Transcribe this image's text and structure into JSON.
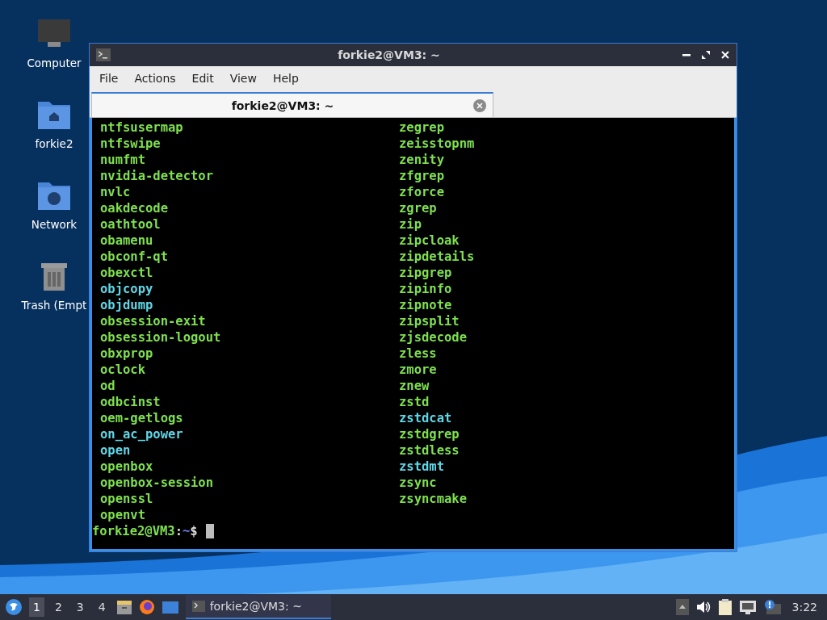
{
  "desktop_icons": [
    {
      "label": "Computer",
      "kind": "computer"
    },
    {
      "label": "forkie2",
      "kind": "home"
    },
    {
      "label": "Network",
      "kind": "network"
    },
    {
      "label": "Trash (Empt",
      "kind": "trash"
    }
  ],
  "window": {
    "title": "forkie2@VM3: ~",
    "menu": [
      "File",
      "Actions",
      "Edit",
      "View",
      "Help"
    ],
    "tabs": [
      {
        "label": "forkie2@VM3: ~",
        "selected": true
      }
    ]
  },
  "terminal": {
    "columns": [
      [
        {
          "text": "ntfsusermap",
          "kind": "executable"
        },
        {
          "text": "ntfswipe",
          "kind": "executable"
        },
        {
          "text": "numfmt",
          "kind": "executable"
        },
        {
          "text": "nvidia-detector",
          "kind": "executable"
        },
        {
          "text": "nvlc",
          "kind": "executable"
        },
        {
          "text": "oakdecode",
          "kind": "executable"
        },
        {
          "text": "oathtool",
          "kind": "executable"
        },
        {
          "text": "obamenu",
          "kind": "executable"
        },
        {
          "text": "obconf-qt",
          "kind": "executable"
        },
        {
          "text": "obexctl",
          "kind": "executable"
        },
        {
          "text": "objcopy",
          "kind": "symlink"
        },
        {
          "text": "objdump",
          "kind": "symlink"
        },
        {
          "text": "obsession-exit",
          "kind": "executable"
        },
        {
          "text": "obsession-logout",
          "kind": "executable"
        },
        {
          "text": "obxprop",
          "kind": "executable"
        },
        {
          "text": "oclock",
          "kind": "executable"
        },
        {
          "text": "od",
          "kind": "executable"
        },
        {
          "text": "odbcinst",
          "kind": "executable"
        },
        {
          "text": "oem-getlogs",
          "kind": "executable"
        },
        {
          "text": "on_ac_power",
          "kind": "symlink"
        },
        {
          "text": "open",
          "kind": "symlink"
        },
        {
          "text": "openbox",
          "kind": "executable"
        },
        {
          "text": "openbox-session",
          "kind": "executable"
        },
        {
          "text": "openssl",
          "kind": "executable"
        },
        {
          "text": "openvt",
          "kind": "executable"
        }
      ],
      [
        {
          "text": "zegrep",
          "kind": "executable"
        },
        {
          "text": "zeisstopnm",
          "kind": "executable"
        },
        {
          "text": "zenity",
          "kind": "executable"
        },
        {
          "text": "zfgrep",
          "kind": "executable"
        },
        {
          "text": "zforce",
          "kind": "executable"
        },
        {
          "text": "zgrep",
          "kind": "executable"
        },
        {
          "text": "zip",
          "kind": "executable"
        },
        {
          "text": "zipcloak",
          "kind": "executable"
        },
        {
          "text": "zipdetails",
          "kind": "executable"
        },
        {
          "text": "zipgrep",
          "kind": "executable"
        },
        {
          "text": "zipinfo",
          "kind": "executable"
        },
        {
          "text": "zipnote",
          "kind": "executable"
        },
        {
          "text": "zipsplit",
          "kind": "executable"
        },
        {
          "text": "zjsdecode",
          "kind": "executable"
        },
        {
          "text": "zless",
          "kind": "executable"
        },
        {
          "text": "zmore",
          "kind": "executable"
        },
        {
          "text": "znew",
          "kind": "executable"
        },
        {
          "text": "zstd",
          "kind": "executable"
        },
        {
          "text": "zstdcat",
          "kind": "symlink"
        },
        {
          "text": "zstdgrep",
          "kind": "executable"
        },
        {
          "text": "zstdless",
          "kind": "executable"
        },
        {
          "text": "zstdmt",
          "kind": "symlink"
        },
        {
          "text": "zsync",
          "kind": "executable"
        },
        {
          "text": "zsyncmake",
          "kind": "executable"
        }
      ]
    ],
    "prompt": {
      "user": "forkie2@VM3",
      "separator": ":",
      "path": "~",
      "symbol": "$"
    }
  },
  "taskbar": {
    "workspaces": [
      {
        "label": "1",
        "selected": true
      },
      {
        "label": "2",
        "selected": false
      },
      {
        "label": "3",
        "selected": false
      },
      {
        "label": "4",
        "selected": false
      }
    ],
    "task": "forkie2@VM3: ~",
    "clock": "3:22"
  }
}
